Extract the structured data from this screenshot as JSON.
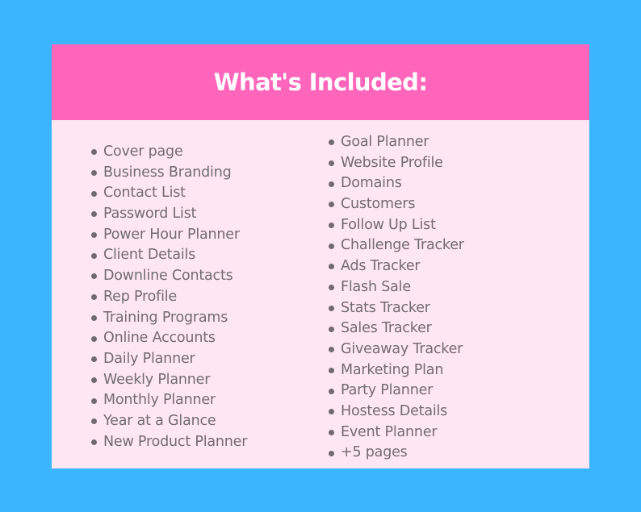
{
  "colors": {
    "background": "#3bb5fd",
    "header": "#ff66bb",
    "panel": "#fee6f3",
    "title_text": "#ffffff",
    "item_text": "#716c72"
  },
  "header": {
    "title": "What's Included:"
  },
  "lists": {
    "left": [
      "Cover page",
      "Business Branding",
      "Contact List",
      "Password List",
      "Power Hour Planner",
      "Client Details",
      "Downline Contacts",
      "Rep Profile",
      "Training Programs",
      "Online Accounts",
      "Daily Planner",
      "Weekly Planner",
      "Monthly Planner",
      "Year at a Glance",
      "New Product Planner"
    ],
    "right": [
      "Goal Planner",
      "Website Profile",
      "Domains",
      "Customers",
      "Follow Up List",
      "Challenge Tracker",
      "Ads Tracker",
      "Flash Sale",
      "Stats Tracker",
      "Sales Tracker",
      "Giveaway Tracker",
      "Marketing Plan",
      "Party Planner",
      "Hostess Details",
      "Event Planner",
      "+5 pages"
    ]
  }
}
